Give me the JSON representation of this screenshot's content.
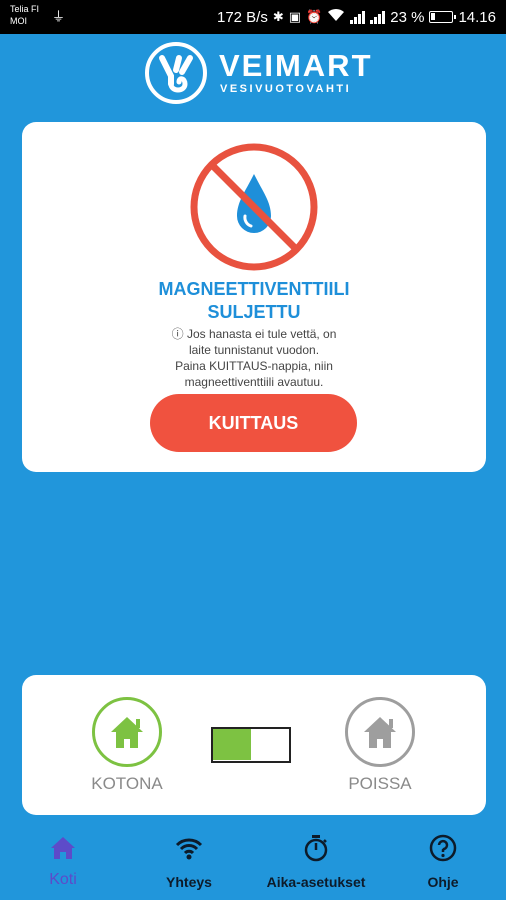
{
  "status_bar": {
    "carrier_line1": "Telia FI",
    "carrier_line2": "MOI",
    "net_speed": "172 B/s",
    "battery_percent": "23 %",
    "battery_level": 0.23,
    "time": "14.16",
    "icons": [
      "usb-icon",
      "bluetooth-icon",
      "nfc-icon",
      "alarm-icon",
      "wifi-icon",
      "signal-icon",
      "battery-icon"
    ]
  },
  "header": {
    "brand": "VEIMART",
    "subtitle": "VESIVUOTOVAHTI"
  },
  "valve_card": {
    "title_line1": "MAGNEETTIVENTTIILI",
    "title_line2": "SULJETTU",
    "info_icon": "ⓘ",
    "message_line1": "Jos hanasta ei tule vettä, on",
    "message_line2": "laite tunnistanut vuodon.",
    "message_line3": "Paina KUITTAUS-nappia, niin",
    "message_line4": "magneettiventtiili avautuu.",
    "ack_button": "KUITTAUS"
  },
  "mode_card": {
    "home_label": "KOTONA",
    "away_label": "POISSA",
    "selected": "home",
    "home_color": "#7dc242",
    "away_color": "#9e9e9e"
  },
  "bottom_nav": {
    "items": [
      {
        "label": "Koti",
        "icon": "home-icon",
        "active": true
      },
      {
        "label": "Yhteys",
        "icon": "wifi-icon",
        "active": false
      },
      {
        "label": "Aika-asetukset",
        "icon": "stopwatch-icon",
        "active": false
      },
      {
        "label": "Ohje",
        "icon": "help-icon",
        "active": false
      }
    ]
  },
  "colors": {
    "background": "#2196db",
    "accent_blue": "#1e8fd9",
    "button_red": "#f0523f",
    "active_nav": "#5d4bc9"
  }
}
